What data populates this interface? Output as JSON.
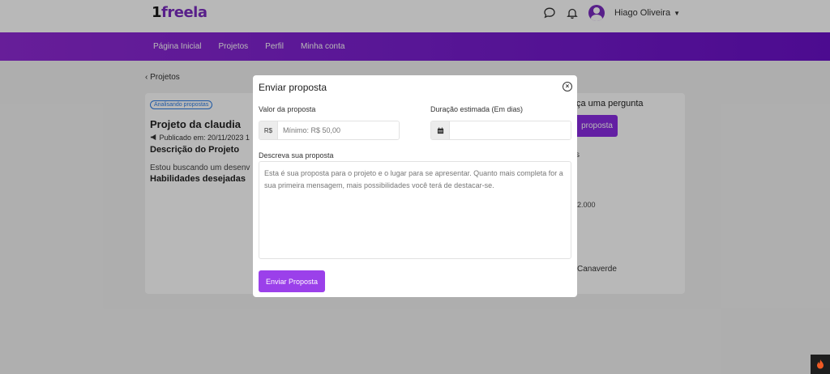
{
  "header": {
    "logo_prefix": "1",
    "logo_text": "freela",
    "user_name": "Hiago Oliveira",
    "icons": [
      "chat-icon",
      "bell-icon",
      "user-avatar-icon",
      "caret-down-icon"
    ]
  },
  "nav": {
    "items": [
      {
        "label": "Página Inicial"
      },
      {
        "label": "Projetos"
      },
      {
        "label": "Perfil"
      },
      {
        "label": "Minha conta"
      }
    ]
  },
  "page": {
    "back_link": "‹ Projetos",
    "project": {
      "status_badge": "Analisando propostas",
      "title": "Projeto da claudia",
      "published": "Publicado em: 20/11/2023 1",
      "description_heading": "Descrição do Projeto",
      "description_text": "Estou buscando um desenv",
      "skills_heading": "Habilidades desejadas"
    },
    "sidebar": {
      "ask_title": "ça uma pergunta",
      "ask_button": "proposta",
      "fragment_1": "s",
      "fragment_2": "2.000",
      "fragment_3": "Canaverde"
    }
  },
  "modal": {
    "title": "Enviar proposta",
    "value_label": "Valor da proposta",
    "value_prefix": "R$",
    "value_placeholder": "Mínimo: R$ 50,00",
    "value_value": "",
    "duration_label": "Duração estimada (Em dias)",
    "duration_value": "",
    "desc_label": "Descreva sua proposta",
    "desc_placeholder": "Esta é sua proposta para o projeto e o lugar para se apresentar. Quanto mais completa for a sua primeira mensagem, mais possibilidades você terá de destacar-se.",
    "submit_label": "Enviar Proposta",
    "icons": [
      "close-icon",
      "calendar-icon"
    ]
  },
  "colors": {
    "brand_purple": "#7b2cbf",
    "nav_gradient_start": "#8f2ad4",
    "nav_gradient_end": "#6a10c8",
    "button_purple": "#9b40ea",
    "badge_blue": "#2a7be4"
  }
}
